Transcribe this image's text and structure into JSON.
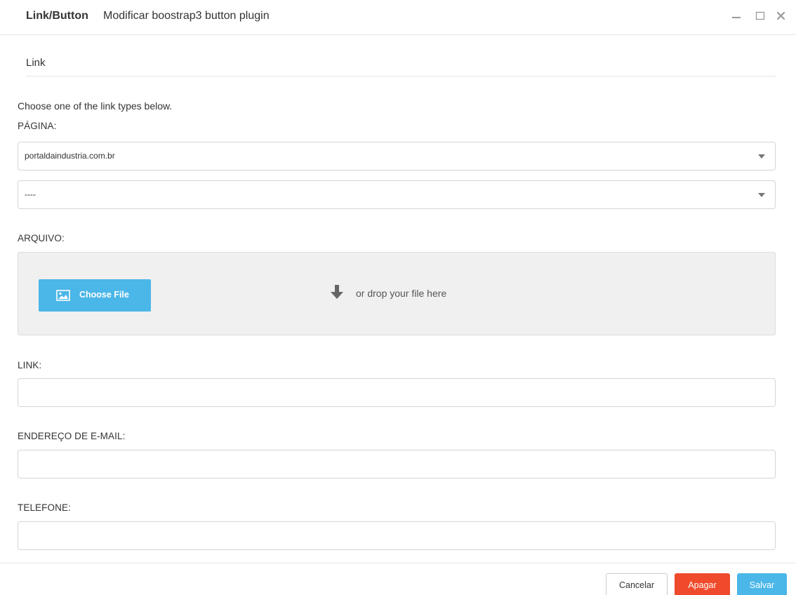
{
  "header": {
    "title": "Link/Button",
    "subtitle": "Modificar boostrap3 button plugin",
    "icons": {
      "minimize": "minimize-icon",
      "maximize": "maximize-icon",
      "close": "close-icon"
    }
  },
  "form": {
    "section_title": "Link",
    "help_text": "Choose one of the link types below.",
    "page_label": "PÁGINA:",
    "site_select_value": "portaldaindustria.com.br",
    "page_select_value": "----",
    "file_label": "ARQUIVO:",
    "choose_file_label": "Choose File",
    "drop_hint": "or drop your file here",
    "link_label": "LINK:",
    "link_value": "",
    "email_label": "ENDEREÇO DE E-MAIL:",
    "email_value": "",
    "phone_label": "TELEFONE:",
    "phone_value": ""
  },
  "footer": {
    "cancel_label": "Cancelar",
    "delete_label": "Apagar",
    "save_label": "Salvar"
  },
  "colors": {
    "primary": "#4bb6e8",
    "danger": "#ef4a2b"
  }
}
